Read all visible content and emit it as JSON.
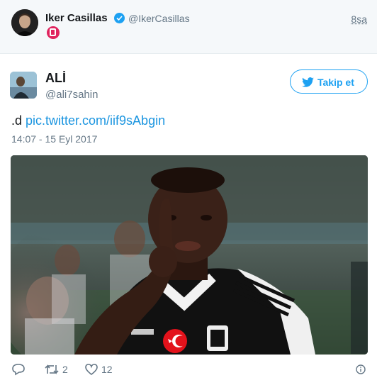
{
  "parent_tweet": {
    "name": "Iker Casillas",
    "handle": "@IkerCasillas",
    "time": "8sa",
    "verified_icon": "verified-icon",
    "badge_icon": "no-phone-icon"
  },
  "tweet": {
    "name": "ALİ",
    "handle": "@ali7sahin",
    "follow_label": "Takip et",
    "text_prefix": ".d ",
    "link_text": "pic.twitter.com/iif9sAbgin",
    "timestamp": "14:07 - 15 Eyl 2017",
    "media_alt": "Football player making a shush gesture",
    "actions": {
      "reply_icon": "reply-icon",
      "retweet_icon": "retweet-icon",
      "retweet_count": "2",
      "like_icon": "heart-icon",
      "like_count": "12",
      "info_icon": "info-icon"
    }
  },
  "colors": {
    "accent": "#1da1f2",
    "link": "#1b95e0",
    "muted": "#657786",
    "parent_bg": "#f5f8fa"
  }
}
